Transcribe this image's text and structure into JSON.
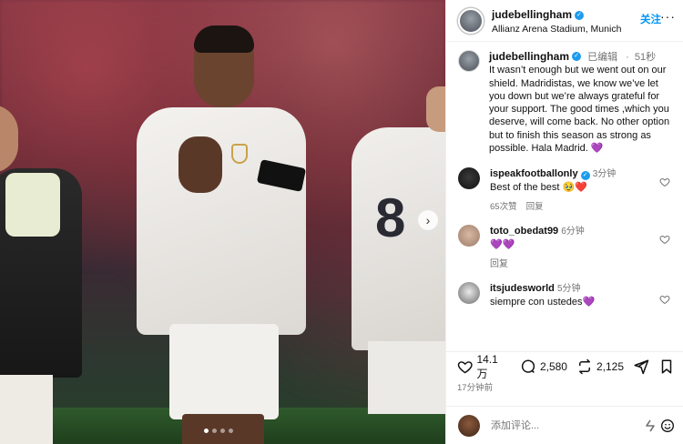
{
  "post": {
    "username": "jude​bellingham",
    "location": "Allianz Arena Stadium, Munich",
    "follow_label": "关注",
    "more_label": "···",
    "edited_label": "已编辑",
    "separator": "·",
    "time_short": "51秒",
    "caption": "It wasn’t enough but we went out on our shield. Madridistas, we know we’ve let you down but we’re always grateful for your support. The good times ,which you deserve, will come back. No other option but to finish this season as strong as possible. Hala Madrid. 💜"
  },
  "comments": [
    {
      "username": "ispeakfootballonly",
      "verified": true,
      "time": "3分钟",
      "text": "Best of the best 🥹❤️",
      "likes": "65次赞",
      "reply_label": "回复"
    },
    {
      "username": "toto_obedat99",
      "verified": false,
      "time": "6分钟",
      "text": "💜💜",
      "reply_label": "回复"
    },
    {
      "username": "itsjudesworld",
      "verified": false,
      "time": "5分钟",
      "text": "siempre con ustedes💜"
    }
  ],
  "stats": {
    "likes": "14.1 万",
    "comments": "2,580",
    "reposts": "2,125",
    "time_ago": "17分钟前"
  },
  "add_comment": {
    "placeholder": "添加评论..."
  },
  "carousel": {
    "next_icon": "chevron-right-icon",
    "slide_count": 4,
    "active_index": 0
  },
  "colors": {
    "link_blue": "#0095f6",
    "verified_blue": "#1d9bf0",
    "muted": "#737373"
  }
}
